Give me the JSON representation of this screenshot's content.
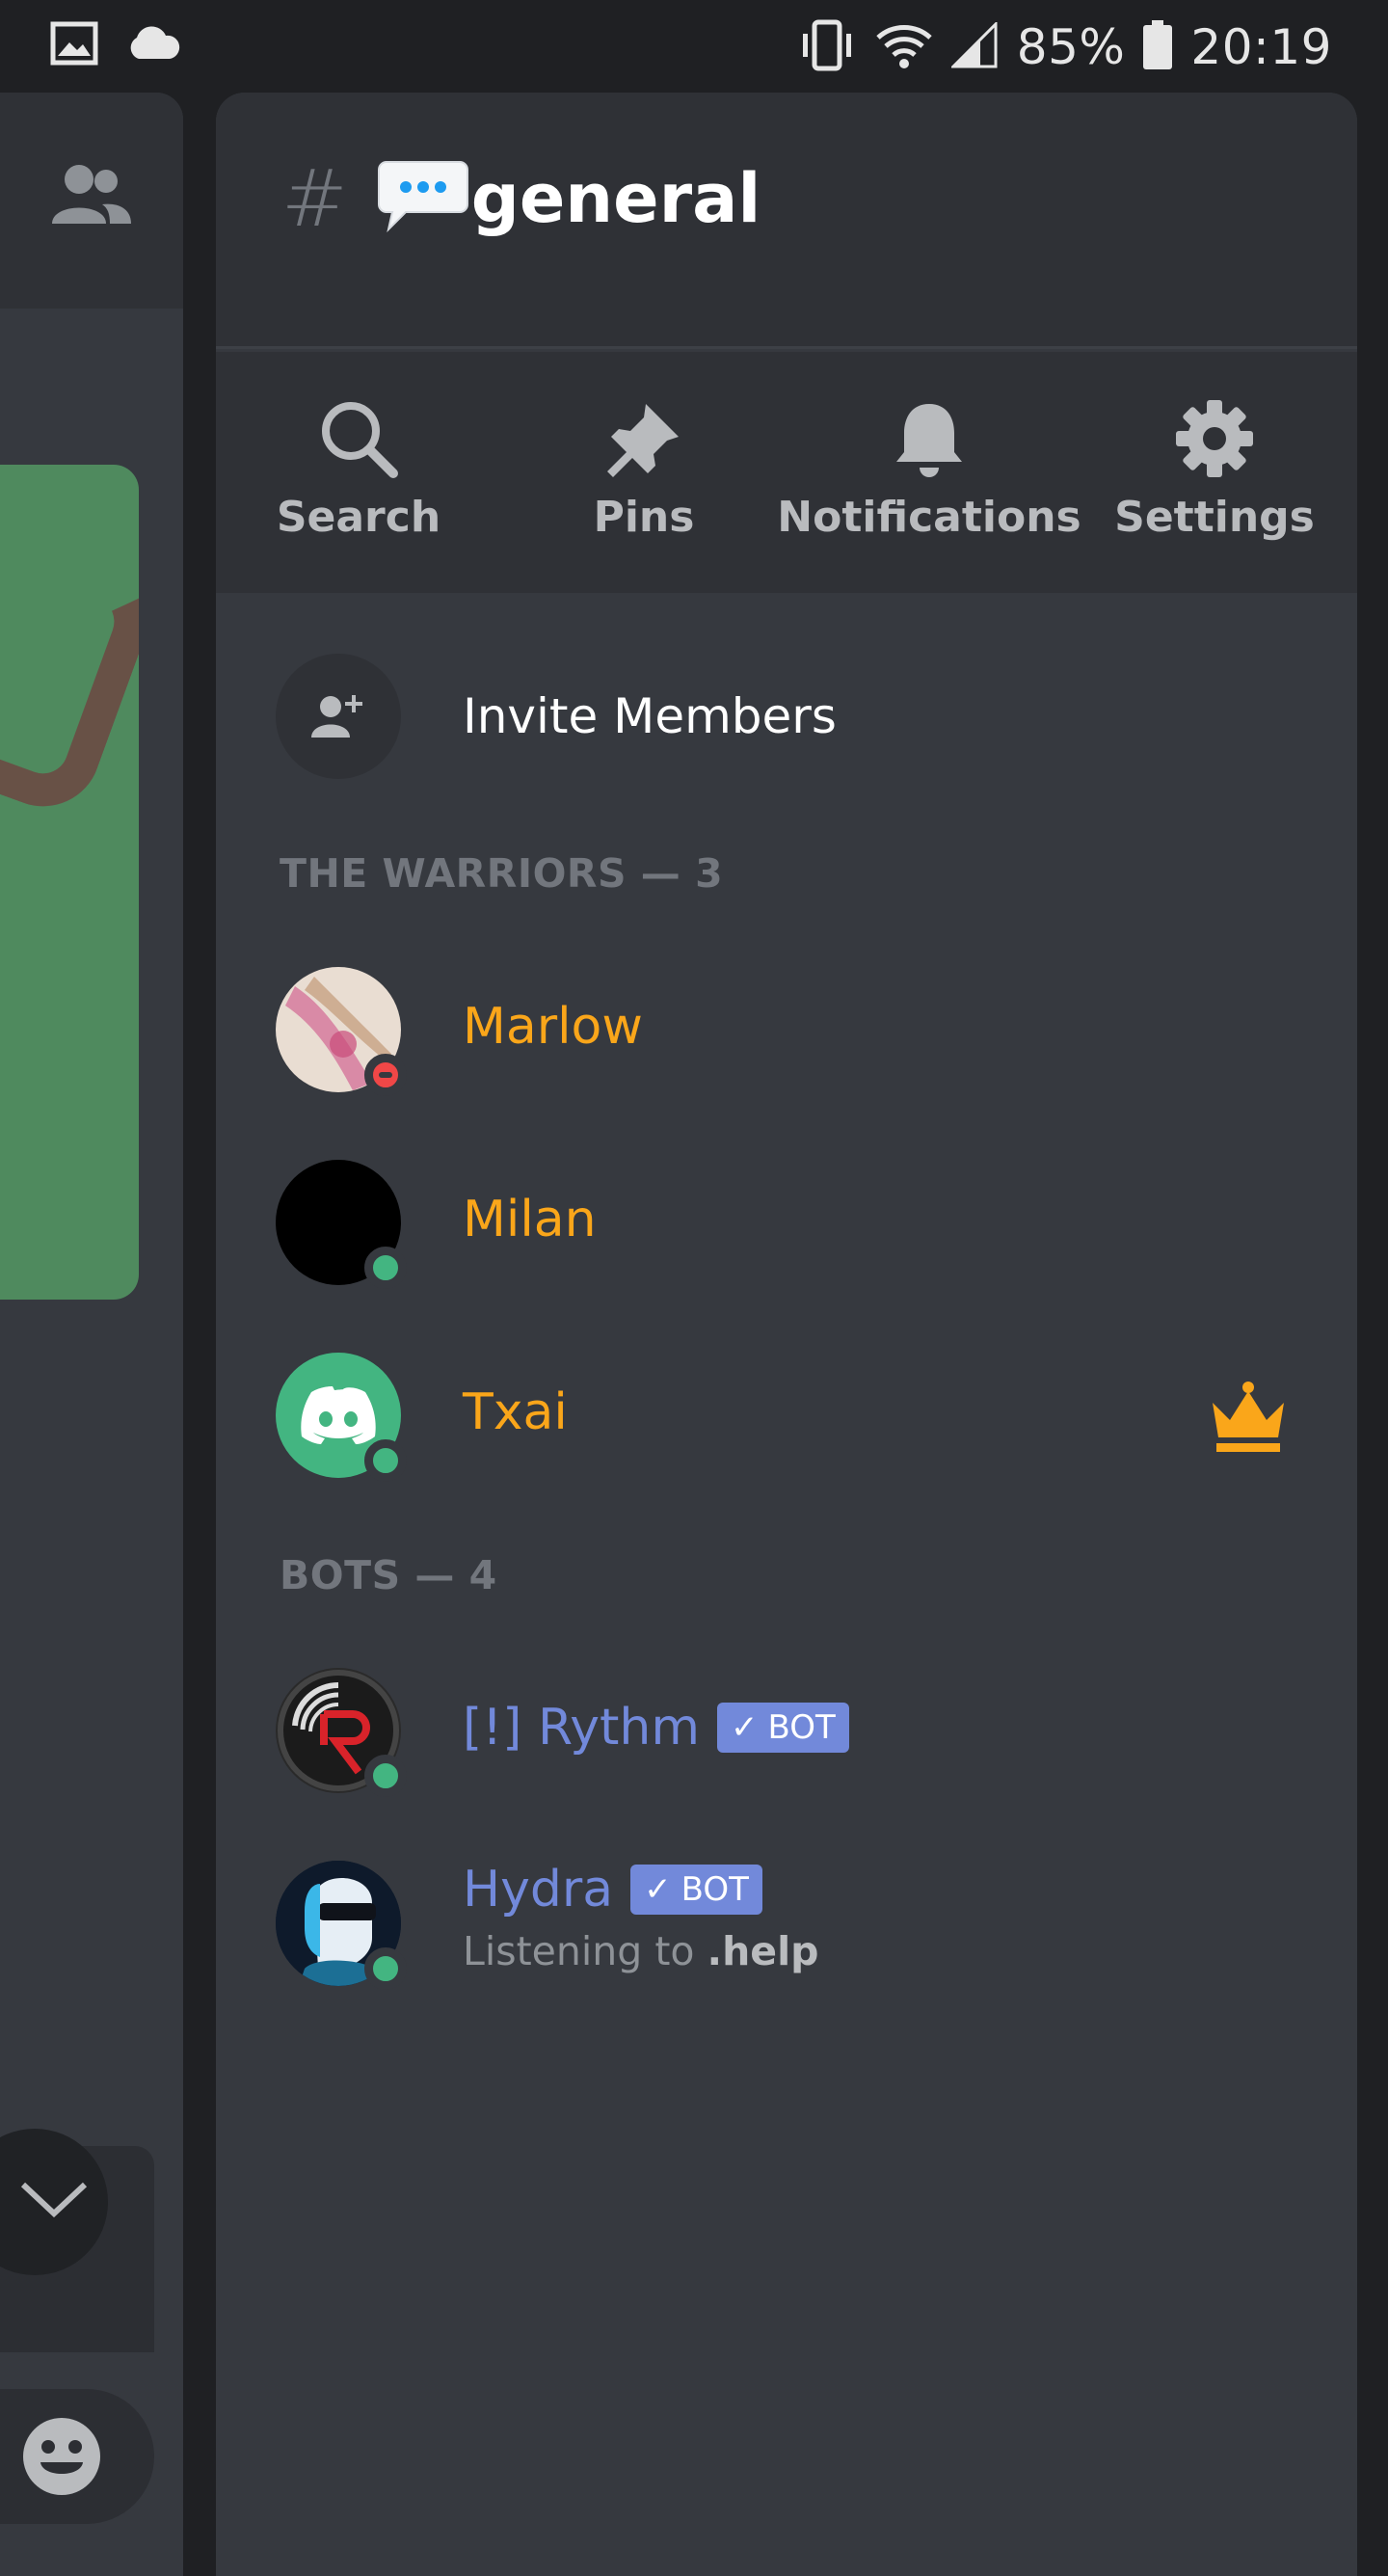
{
  "status_bar": {
    "battery": "85%",
    "time": "20:19",
    "icons": [
      "gallery-icon",
      "cloud-icon",
      "vibrate-icon",
      "wifi-icon",
      "signal-icon",
      "battery-icon"
    ]
  },
  "channel": {
    "hash": "#",
    "emoji": "speech-balloon-icon",
    "name": "general"
  },
  "actions": [
    {
      "label": "Search",
      "icon": "search-icon"
    },
    {
      "label": "Pins",
      "icon": "pin-icon"
    },
    {
      "label": "Notifications",
      "icon": "bell-icon"
    },
    {
      "label": "Settings",
      "icon": "gear-icon"
    }
  ],
  "invite": {
    "label": "Invite Members",
    "icon": "add-member-icon"
  },
  "sections": [
    {
      "header": "THE WARRIORS — 3",
      "members": [
        {
          "name": "Marlow",
          "status": "dnd"
        },
        {
          "name": "Milan",
          "status": "online"
        },
        {
          "name": "Txai",
          "status": "online",
          "owner": true
        }
      ]
    },
    {
      "header": "BOTS — 4",
      "members": [
        {
          "name": "[!] Rythm",
          "status": "online",
          "tag": "BOT"
        },
        {
          "name": "Hydra",
          "status": "online",
          "tag": "BOT",
          "activity_prefix": "Listening to ",
          "activity_bold": ".help"
        }
      ]
    }
  ],
  "colors": {
    "role_color": "#faa61a",
    "bot_color": "#7289da",
    "online": "#43b581",
    "dnd": "#f04747",
    "drawer_bg": "#36393f",
    "header_bg": "#2f3136"
  }
}
